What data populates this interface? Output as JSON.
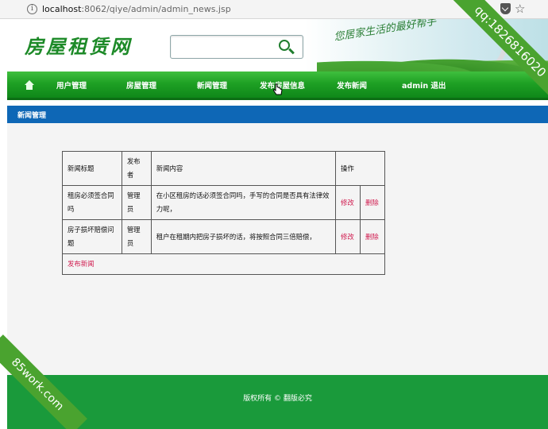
{
  "browser": {
    "url_host": "localhost",
    "url_path": ":8062/qiye/admin/admin_news.jsp"
  },
  "header": {
    "logo_text": "房屋租赁网",
    "search_placeholder": "",
    "slogan": "您居家生活的最好帮手"
  },
  "nav": {
    "items": [
      {
        "label": "用户管理"
      },
      {
        "label": "房屋管理"
      },
      {
        "label": "新闻管理"
      },
      {
        "label": "发布房屋信息"
      },
      {
        "label": "发布新闻"
      },
      {
        "label": "admin 退出"
      }
    ]
  },
  "section_title": "新闻管理",
  "table": {
    "headers": [
      "新闻标题",
      "发布者",
      "新闻内容",
      "操作"
    ],
    "rows": [
      {
        "title": "租房必须签合同吗",
        "author": "管理员",
        "content": "在小区租房的话必须签合同吗，手写的合同是否具有法律效力呢，",
        "edit": "修改",
        "delete": "删除"
      },
      {
        "title": "房子损坏赔偿问题",
        "author": "管理员",
        "content": "租户在租期内把房子损坏的话，将按照合同三倍赔偿，",
        "edit": "修改",
        "delete": "删除"
      }
    ],
    "add_link": "发布新闻"
  },
  "footer": {
    "text": "版权所有 © 翻版必究"
  },
  "watermarks": {
    "top_right": "qq:1826816020",
    "bottom_left": "85work.com"
  },
  "colors": {
    "nav_green": "#1ea024",
    "subbar_blue": "#0e67b6",
    "footer_green": "#1a9a3b",
    "link_red": "#d01a4e"
  }
}
